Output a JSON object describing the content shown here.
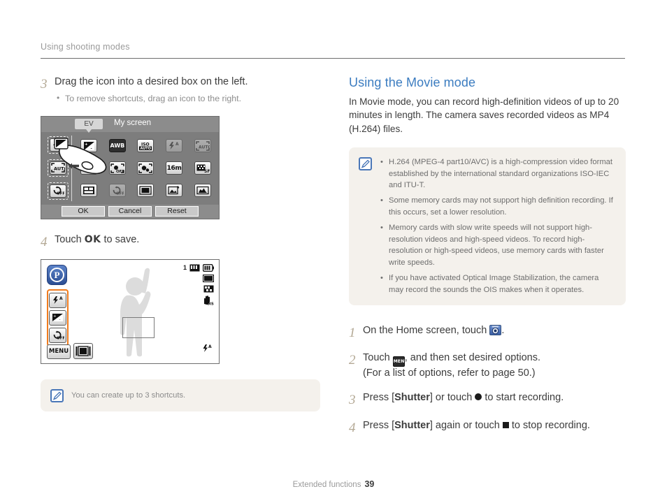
{
  "running_head": "Using shooting modes",
  "footer": {
    "section": "Extended functions",
    "page": "39"
  },
  "left": {
    "step3": {
      "num": "3",
      "text": "Drag the icon into a desired box on the left.",
      "bullets": [
        "To remove shortcuts, drag an icon to the right."
      ]
    },
    "myscreen": {
      "tooltip": "EV",
      "title": "My screen",
      "slots": [
        "flash-auto-icon",
        "af-auto-icon",
        "timer-off-icon"
      ],
      "grid": [
        "ev-icon",
        "awb-icon",
        "iso-auto-icon",
        "flash-auto-icon",
        "af-auto-icon",
        "drive-icon",
        "face-detect-off-icon",
        "face-detect-icon",
        "16m-icon",
        "sf-quality-icon",
        "split-icon",
        "timer-off-icon",
        "frame-icon",
        "photo-edit-icon",
        "histogram-icon"
      ],
      "buttons": [
        "OK",
        "Cancel",
        "Reset"
      ]
    },
    "step4": {
      "num": "4",
      "pre": "Touch ",
      "ok": "OK",
      "post": " to save."
    },
    "preview": {
      "mode_letter": "P",
      "count": "1",
      "shortcuts": [
        "flash-auto-icon",
        "ev-icon",
        "timer-off-icon"
      ],
      "menu_label": "MENU",
      "status_icons": [
        "memory-card-icon",
        "battery-icon",
        "photo-size-icon",
        "quality-icon",
        "ois-icon"
      ]
    },
    "note": {
      "icon": "note-pen-icon",
      "text": "You can create up to 3 shortcuts."
    }
  },
  "right": {
    "heading": "Using the Movie mode",
    "intro": "In Movie mode, you can record high-definition videos of up to 20 minutes in length. The camera saves recorded videos as MP4 (H.264) files.",
    "note": {
      "icon": "note-pen-icon",
      "bullets": [
        "H.264 (MPEG-4 part10/AVC) is a high-compression video format established by the international standard organizations ISO-IEC and ITU-T.",
        "Some memory cards may not support high definition recording. If this occurs, set a lower resolution.",
        "Memory cards with slow write speeds will not support high-resolution videos and high-speed videos. To record high-resolution or high-speed videos, use memory cards with faster write speeds.",
        "If you have activated Optical Image Stabilization, the camera may record the sounds the OIS makes when it operates."
      ]
    },
    "steps": [
      {
        "num": "1",
        "pre": "On the Home screen, touch ",
        "icon": "movie-mode-icon",
        "post": "."
      },
      {
        "num": "2",
        "pre": "Touch ",
        "icon": "menu-icon",
        "post": ", and then set desired options.",
        "line2": "(For a list of options, refer to page 50.)"
      },
      {
        "num": "3",
        "pre": "Press [",
        "bold": "Shutter",
        "mid": "] or touch ",
        "icon": "record-dot-icon",
        "post": " to start recording."
      },
      {
        "num": "4",
        "pre": "Press [",
        "bold": "Shutter",
        "mid": "] again or touch ",
        "icon": "stop-square-icon",
        "post": " to stop recording."
      }
    ]
  },
  "colors": {
    "heading_blue": "#3b7cc0",
    "step_number": "#b3a894",
    "note_bg": "#f4f1ec",
    "highlight_orange": "#f07b1d"
  }
}
